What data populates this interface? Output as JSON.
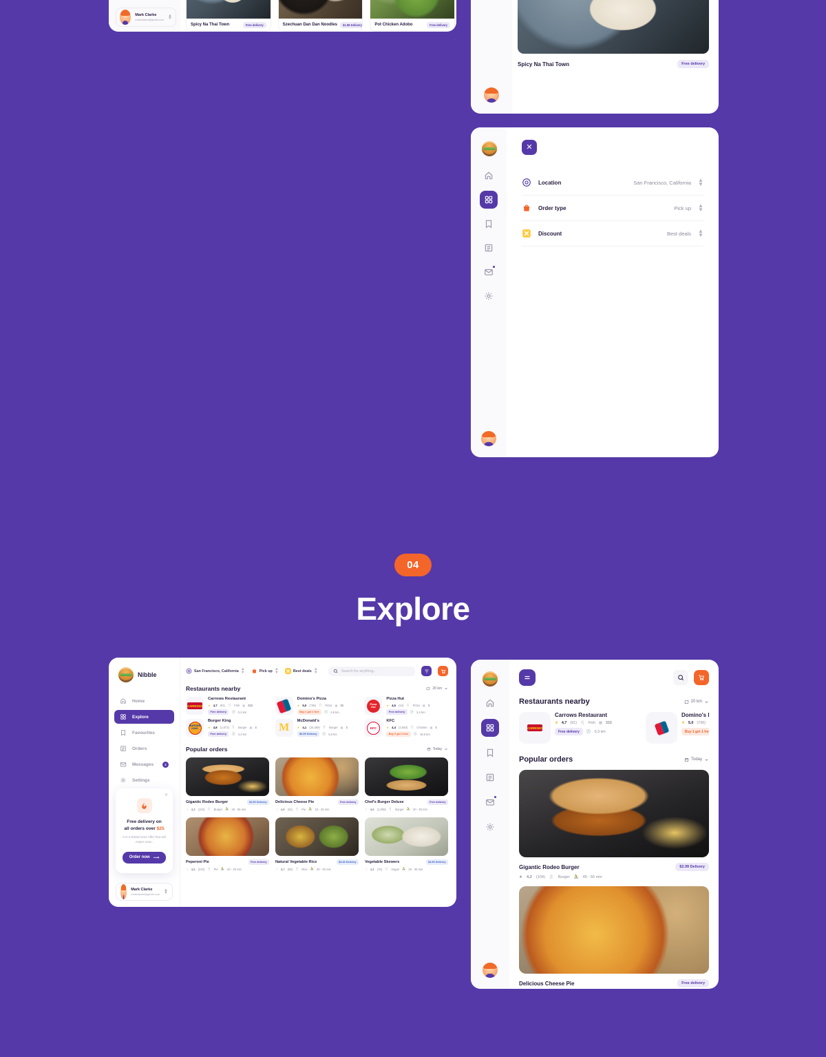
{
  "section": {
    "number": "04",
    "title": "Explore"
  },
  "brand": {
    "name": "Nibble"
  },
  "user": {
    "name": "Mark Clarke",
    "email": "markclarke@gmail.com"
  },
  "top_strip_cards": [
    {
      "title": "Spicy Na Thai Town",
      "tag": "Free delivery"
    },
    {
      "title": "Szechuan Dan Dan Noodles",
      "tag": "$1.99 Delivery"
    },
    {
      "title": "Pot Chicken Adobo",
      "tag": "Free delivery"
    }
  ],
  "dish_card": {
    "title": "Spicy Na Thai Town",
    "tag": "Free delivery"
  },
  "filters_modal": {
    "close_label": "✕",
    "rows": [
      {
        "icon": "target-icon",
        "label": "Location",
        "value": "San Francisco, California"
      },
      {
        "icon": "bag-icon",
        "label": "Order type",
        "value": "Pick up"
      },
      {
        "icon": "discount-icon",
        "label": "Discount",
        "value": "Best deals"
      }
    ]
  },
  "sidebar": {
    "items": [
      {
        "label": "Home",
        "icon": "home-icon",
        "active": false,
        "badge": ""
      },
      {
        "label": "Explore",
        "icon": "grid-icon",
        "active": true,
        "badge": ""
      },
      {
        "label": "Favourites",
        "icon": "bookmark-icon",
        "active": false,
        "badge": ""
      },
      {
        "label": "Orders",
        "icon": "document-icon",
        "active": false,
        "badge": ""
      },
      {
        "label": "Messages",
        "icon": "mail-icon",
        "active": false,
        "badge": "2"
      },
      {
        "label": "Settings",
        "icon": "gear-icon",
        "active": false,
        "badge": ""
      }
    ]
  },
  "promo": {
    "title_line1": "Free delivery on",
    "title_line2_pre": "all orders over ",
    "title_amount": "$25",
    "subtitle": "It is a limited time offer that will expire soon.",
    "button": "Order now",
    "close": "✕"
  },
  "toolbar": {
    "location": "San Francisco, California",
    "order_type": "Pick up",
    "discount": "Best deals",
    "search_placeholder": "Search for anything...",
    "filter_icon": "filter-icon",
    "cart_icon": "cart-icon"
  },
  "restaurants_section": {
    "heading": "Restaurants nearby",
    "distance": "20 km"
  },
  "restaurants": [
    {
      "name": "Carrows Restaurant",
      "rating": "4,7",
      "reviews": "(91)",
      "cuisine": "Fish",
      "price": "$$$",
      "pill": "Free delivery",
      "pill_type": "free",
      "distance": "0,3 km",
      "logo": "carrows"
    },
    {
      "name": "Domino's Pizza",
      "rating": "5,0",
      "reviews": "(736)",
      "cuisine": "Pizza",
      "price": "$$",
      "pill": "Buy 1 get 1 free",
      "pill_type": "bogo",
      "distance": "2,8 km",
      "logo": "domino"
    },
    {
      "name": "Pizza Hut",
      "rating": "4,6",
      "reviews": "(24)",
      "cuisine": "Pizza",
      "price": "$",
      "pill": "Free delivery",
      "pill_type": "free",
      "distance": "3,4 km",
      "logo": "pizzahut"
    },
    {
      "name": "Burger King",
      "rating": "4,8",
      "reviews": "(1,873)",
      "cuisine": "Burger",
      "price": "$",
      "pill": "Free delivery",
      "pill_type": "free",
      "distance": "4,3 km",
      "logo": "bk"
    },
    {
      "name": "McDonald's",
      "rating": "4,1",
      "reviews": "(20,359)",
      "cuisine": "Burger",
      "price": "$",
      "pill": "$0.99 Delivery",
      "pill_type": "paid",
      "distance": "5,0 km",
      "logo": "mcd"
    },
    {
      "name": "KFC",
      "rating": "4,4",
      "reviews": "(2,583)",
      "cuisine": "Chicken",
      "price": "$",
      "pill": "Buy 2 get 1 free",
      "pill_type": "bogo",
      "distance": "18,6 km",
      "logo": "kfc"
    }
  ],
  "popular_section": {
    "heading": "Popular orders",
    "period": "Today"
  },
  "popular_orders": [
    {
      "name": "Gigantic Rodeo Burger",
      "tag": "$2.99 Delivery",
      "rating": "4,3",
      "reviews": "(104)",
      "cuisine": "Burger",
      "time": "45 - 55 min",
      "img": "img-burger1"
    },
    {
      "name": "Delicious Cheese Pie",
      "tag": "Free delivery",
      "rating": "4,9",
      "reviews": "(31)",
      "cuisine": "Pie",
      "time": "15 - 25 min",
      "img": "img-pizza1"
    },
    {
      "name": "Chef's Burger Deluxe",
      "tag": "Free delivery",
      "rating": "4,6",
      "reviews": "(1,006)",
      "cuisine": "Burger",
      "time": "20 - 30 min",
      "img": "img-chef"
    },
    {
      "name": "Peperoni Pie",
      "tag": "Free delivery",
      "rating": "4,5",
      "reviews": "(210)",
      "cuisine": "Pie",
      "time": "20 - 30 min",
      "img": "img-pep"
    },
    {
      "name": "Natural Vegetable Rice",
      "tag": "$3.45 Delivery",
      "rating": "4,7",
      "reviews": "(58)",
      "cuisine": "Rice",
      "time": "30 - 40 min",
      "img": "img-skewer"
    },
    {
      "name": "Vegetable Skewers",
      "tag": "$4.99 Delivery",
      "rating": "4,2",
      "reviews": "(76)",
      "cuisine": "Vegan",
      "time": "25 - 35 min",
      "img": "img-rice"
    }
  ],
  "mobile_popular": [
    {
      "name": "Gigantic Rodeo Burger",
      "tag": "$2.99 Delivery",
      "rating": "4,3",
      "reviews": "(104)",
      "cuisine": "Burger",
      "time": "45 - 55 min",
      "img": "img-bigburger"
    },
    {
      "name": "Delicious Cheese Pie",
      "tag": "Free delivery",
      "rating": "4,9",
      "reviews": "(31)",
      "cuisine": "Pie",
      "time": "15 - 25 min",
      "img": "img-bigpizza"
    }
  ],
  "colors": {
    "background": "#5539a8",
    "accent": "#5539a8",
    "orange": "#f4652a",
    "star": "#f5b820"
  }
}
